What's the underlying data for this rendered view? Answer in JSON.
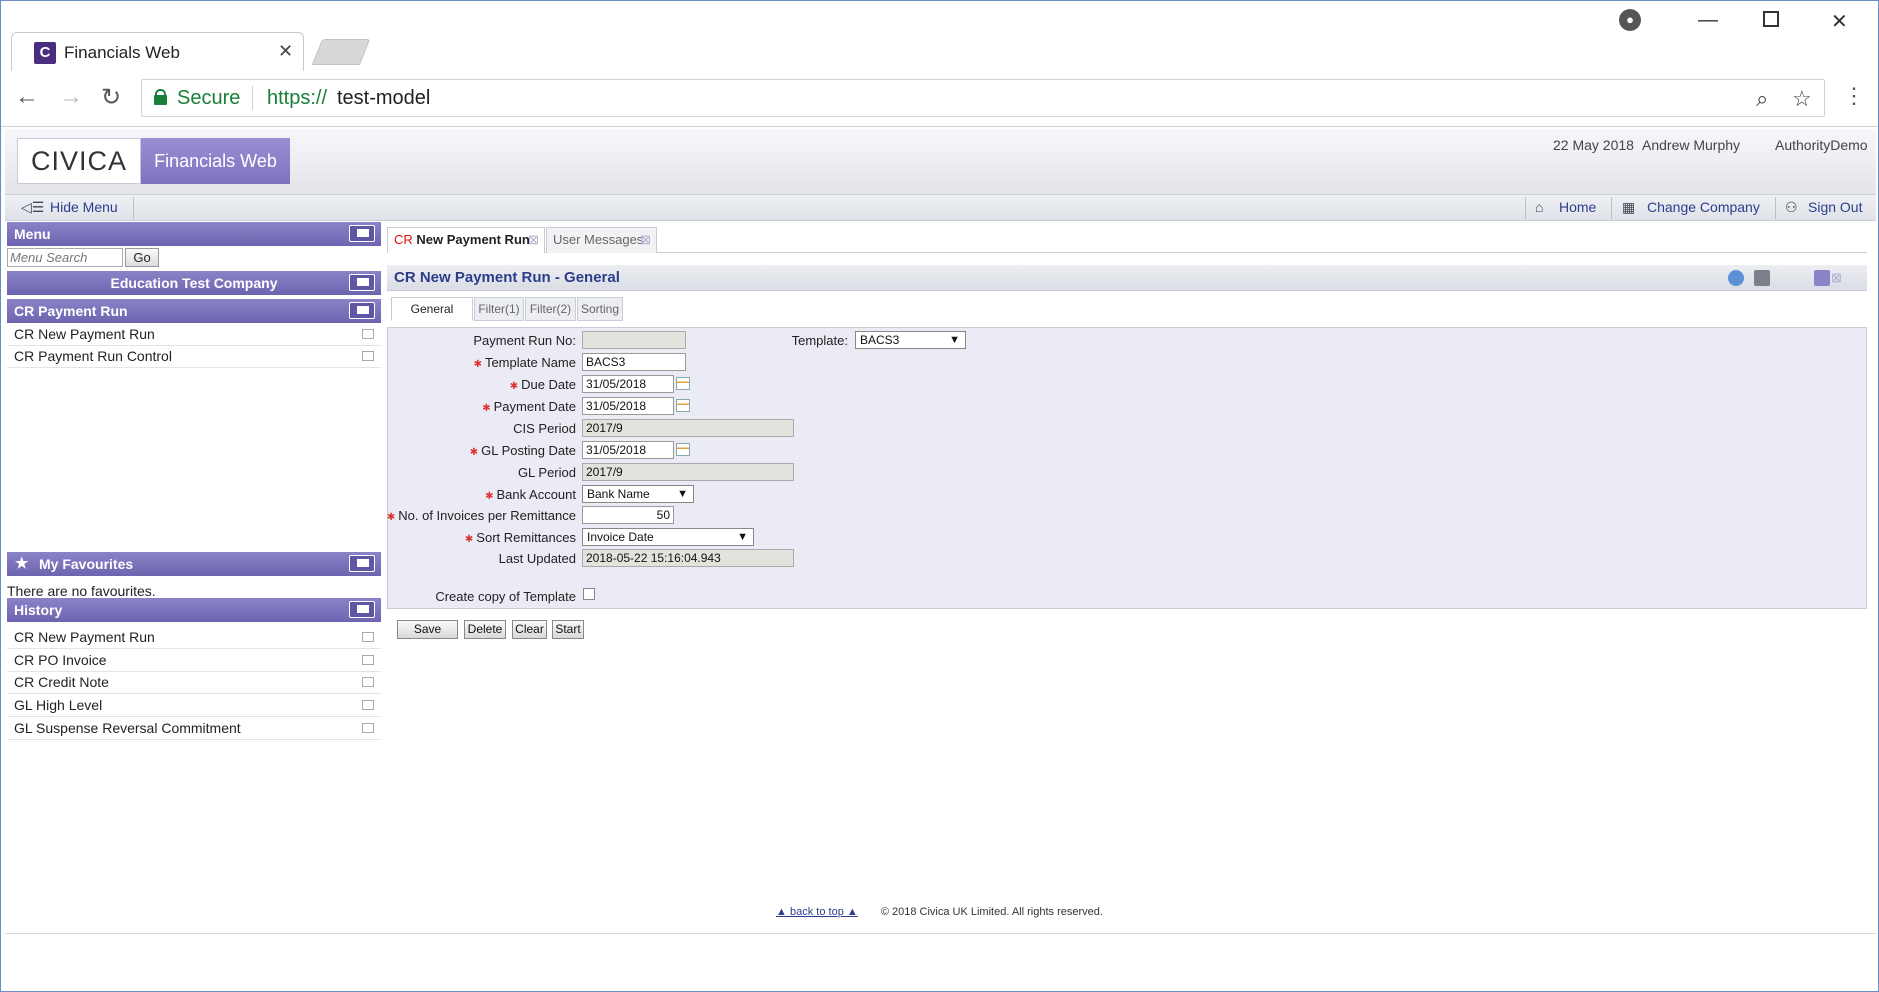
{
  "browser": {
    "tab_title": "Financials Web",
    "tab_favicon": "C",
    "secure_label": "Secure",
    "url_scheme": "https://",
    "url_host": "test-model"
  },
  "header": {
    "logo_text": "CIVICA",
    "brand": "Financials Web",
    "date": "22 May 2018",
    "user": "Andrew Murphy",
    "authority": "AuthorityDemo"
  },
  "strip": {
    "hide_menu": "Hide Menu",
    "home": "Home",
    "change_company": "Change Company",
    "sign_out": "Sign Out"
  },
  "menu": {
    "title": "Menu",
    "search_placeholder": "Menu Search",
    "go": "Go",
    "company": "Education Test Company",
    "section": "CR Payment Run",
    "items": [
      "CR New Payment Run",
      "CR Payment Run Control"
    ]
  },
  "favourites": {
    "title": "My Favourites",
    "empty": "There are no favourites."
  },
  "history": {
    "title": "History",
    "items": [
      "CR New Payment Run",
      "CR PO Invoice",
      "CR Credit Note",
      "GL High Level",
      "GL Suspense Reversal Commitment"
    ]
  },
  "content_tabs": [
    {
      "prefix": "CR",
      "label": "New Payment Run"
    },
    {
      "label": "User Messages"
    }
  ],
  "form": {
    "title": "CR New Payment Run - General",
    "subtabs": [
      "General",
      "Filter(1)",
      "Filter(2)",
      "Sorting"
    ],
    "fields": {
      "payment_run_no": {
        "label": "Payment Run No:",
        "value": ""
      },
      "template": {
        "label": "Template:",
        "value": "BACS3"
      },
      "template_name": {
        "label": "Template Name",
        "value": "BACS3"
      },
      "due_date": {
        "label": "Due Date",
        "value": "31/05/2018"
      },
      "payment_date": {
        "label": "Payment Date",
        "value": "31/05/2018"
      },
      "cis_period": {
        "label": "CIS Period",
        "value": "2017/9"
      },
      "gl_posting_date": {
        "label": "GL Posting Date",
        "value": "31/05/2018"
      },
      "gl_period": {
        "label": "GL Period",
        "value": "2017/9"
      },
      "bank_account": {
        "label": "Bank Account",
        "value": "Bank Name"
      },
      "invoices_per_remittance": {
        "label": "No. of Invoices per Remittance",
        "value": "50"
      },
      "sort_remittances": {
        "label": "Sort Remittances",
        "value": "Invoice Date"
      },
      "last_updated": {
        "label": "Last Updated",
        "value": "2018-05-22 15:16:04.943"
      },
      "create_copy": {
        "label": "Create copy of Template",
        "checked": false
      }
    },
    "buttons": {
      "save": "Save",
      "delete": "Delete",
      "clear": "Clear",
      "start": "Start"
    }
  },
  "footer": {
    "back_to_top": "back to top",
    "copyright": "© 2018 Civica UK Limited. All rights reserved."
  },
  "colors": {
    "accent": "#6d64b0",
    "secure_green": "#188038",
    "required": "#d33"
  }
}
